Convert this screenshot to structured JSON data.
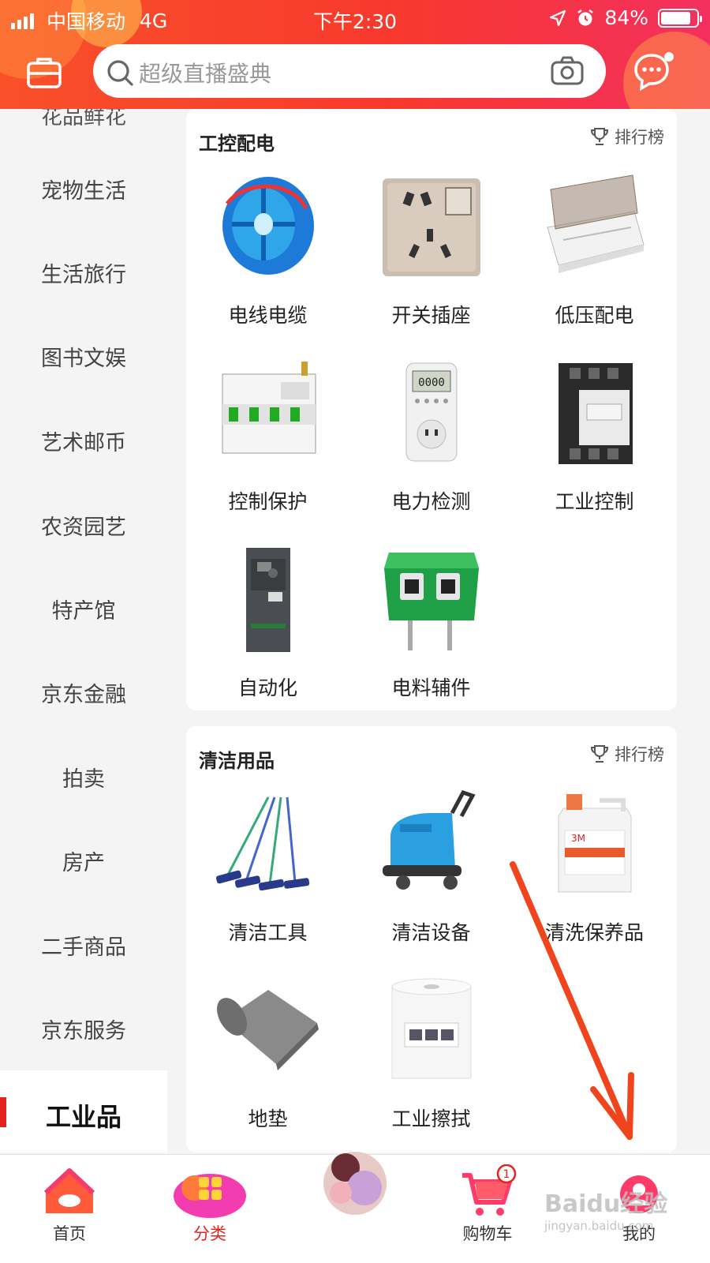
{
  "status_bar": {
    "carrier": "中国移动",
    "network": "4G",
    "time": "下午2:30",
    "battery": "84%",
    "battery_level": 0.84
  },
  "search": {
    "placeholder": "超级直播盛典",
    "icons": [
      "menu-icon",
      "search-icon",
      "camera-icon",
      "message-icon"
    ]
  },
  "sidebar": {
    "items": [
      "宠物生活",
      "生活旅行",
      "图书文娱",
      "艺术邮币",
      "农资园艺",
      "特产馆",
      "京东金融",
      "拍卖",
      "房产",
      "二手商品",
      "京东服务"
    ],
    "active": "工业品"
  },
  "sections": [
    {
      "title": "工控配电",
      "rank_label": "排行榜",
      "items": [
        "电线电缆",
        "开关插座",
        "低压配电",
        "控制保护",
        "电力检测",
        "工业控制",
        "自动化",
        "电料辅件"
      ]
    },
    {
      "title": "清洁用品",
      "rank_label": "排行榜",
      "items": [
        "清洁工具",
        "清洁设备",
        "清洗保养品",
        "地垫",
        "工业擦拭"
      ]
    }
  ],
  "bottom_nav": {
    "items": [
      {
        "label": "首页"
      },
      {
        "label": "分类"
      },
      {
        "label": ""
      },
      {
        "label": "购物车",
        "badge": "1"
      },
      {
        "label": "我的"
      }
    ],
    "active": "分类"
  },
  "watermark": {
    "text": "Baidu经验",
    "sub": "jingyan.baidu.com"
  },
  "colors": {
    "accent": "#e4231e",
    "header_start": "#f9502a",
    "header_end": "#f42f5e",
    "arrow": "#f0451c"
  }
}
